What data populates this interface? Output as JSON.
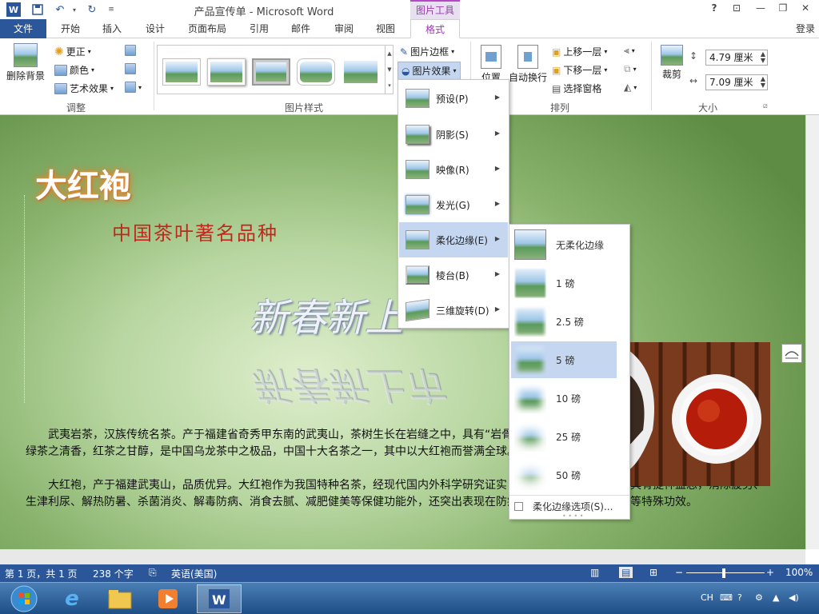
{
  "window": {
    "title": "产品宣传单 - Microsoft Word",
    "context_group": "图片工具",
    "help": "?",
    "signin": "登录"
  },
  "tabs": [
    {
      "label": "文件"
    },
    {
      "label": "开始"
    },
    {
      "label": "插入"
    },
    {
      "label": "设计"
    },
    {
      "label": "页面布局"
    },
    {
      "label": "引用"
    },
    {
      "label": "邮件"
    },
    {
      "label": "审阅"
    },
    {
      "label": "视图"
    },
    {
      "label": "格式"
    }
  ],
  "ribbon": {
    "adjust": {
      "remove_bg": "删除背景",
      "corrections": "更正",
      "color": "颜色",
      "artistic": "艺术效果",
      "label": "调整"
    },
    "styles": {
      "label": "图片样式"
    },
    "picture_cmds": {
      "border": "图片边框",
      "effects": "图片效果"
    },
    "arrange": {
      "position": "位置",
      "wrap": "自动换行",
      "forward": "上移一层",
      "backward": "下移一层",
      "selection_pane": "选择窗格",
      "label": "排列"
    },
    "size": {
      "crop": "裁剪",
      "height": "4.79 厘米",
      "width": "7.09 厘米",
      "label": "大小"
    }
  },
  "document": {
    "heading": "大红袍",
    "subheading": "中国茶叶著名品种",
    "wordart": "新春新上",
    "wordart_reflection": "新春新上市",
    "para1": "武夷岩茶，汉族传统名茶。产于福建省奇秀甲东南的武夷山，茶树生长在岩缝之中，具有“岩骨花香”的岩韵，有“茶中之王”的美誉。武夷岩茶具有绿茶之清香，红茶之甘醇，是中国乌龙茶中之极品，中国十大名茶之一，其中以大红袍而誉满全球。",
    "para2": "大红袍，产于福建武夷山，品质优异。大红袍作为我国特种名茶，经现代国内外科学研究证实，大红袍除了与一般茶叶具有提神益思，消除疲劳、生津利尿、解热防暑、杀菌消炎、解毒防病、消食去腻、减肥健美等保健功能外，还突出表现在防癌症、降血脂、抗衰老、等特殊功效。"
  },
  "effects_menu": [
    {
      "label": "预设(P)"
    },
    {
      "label": "阴影(S)"
    },
    {
      "label": "映像(R)"
    },
    {
      "label": "发光(G)"
    },
    {
      "label": "柔化边缘(E)"
    },
    {
      "label": "棱台(B)"
    },
    {
      "label": "三维旋转(D)"
    }
  ],
  "soft_edges_menu": {
    "items": [
      {
        "label": "无柔化边缘"
      },
      {
        "label": "1 磅"
      },
      {
        "label": "2.5 磅"
      },
      {
        "label": "5 磅"
      },
      {
        "label": "10 磅"
      },
      {
        "label": "25 磅"
      },
      {
        "label": "50 磅"
      }
    ],
    "options": "柔化边缘选项(S)..."
  },
  "status": {
    "page": "第 1 页，共 1 页",
    "words": "238 个字",
    "language": "英语(美国)",
    "zoom": "100%"
  },
  "taskbar": {
    "lang": "CH"
  },
  "colors": {
    "word_blue": "#2b579a",
    "context_purple": "#9b37b0",
    "heading_red": "#c0281e",
    "menu_highlight": "#c5d7f0"
  }
}
